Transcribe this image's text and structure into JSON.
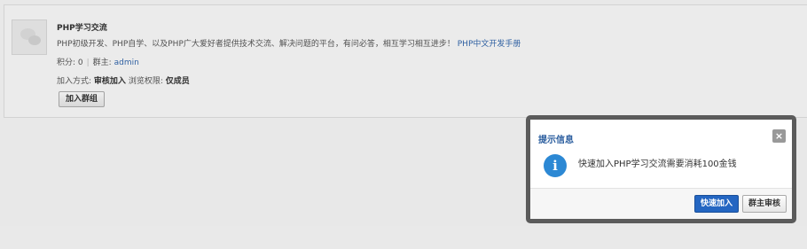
{
  "group": {
    "name": "PHP学习交流",
    "description": "PHP初级开发、PHP自学、以及PHP广大爱好者提供技术交流、解决问题的平台，有问必答，相互学习相互进步！",
    "description_link": "PHP中文开发手册",
    "points_label": "积分: 0",
    "owner_label": "群主:",
    "owner_name": "admin",
    "join_method_label": "加入方式:",
    "join_method_value": "审核加入",
    "browse_perm_label": "浏览权限:",
    "browse_perm_value": "仅成员",
    "join_button": "加入群组"
  },
  "dialog": {
    "title": "提示信息",
    "close_glyph": "×",
    "info_glyph": "i",
    "message": "快速加入PHP学习交流需要消耗100金钱",
    "primary_button": "快速加入",
    "secondary_button": "群主审核"
  },
  "colors": {
    "dialog_title": "#2a5d9e",
    "primary_button": "#2466c2",
    "info_icon": "#2c88d4",
    "link": "#3366aa"
  }
}
